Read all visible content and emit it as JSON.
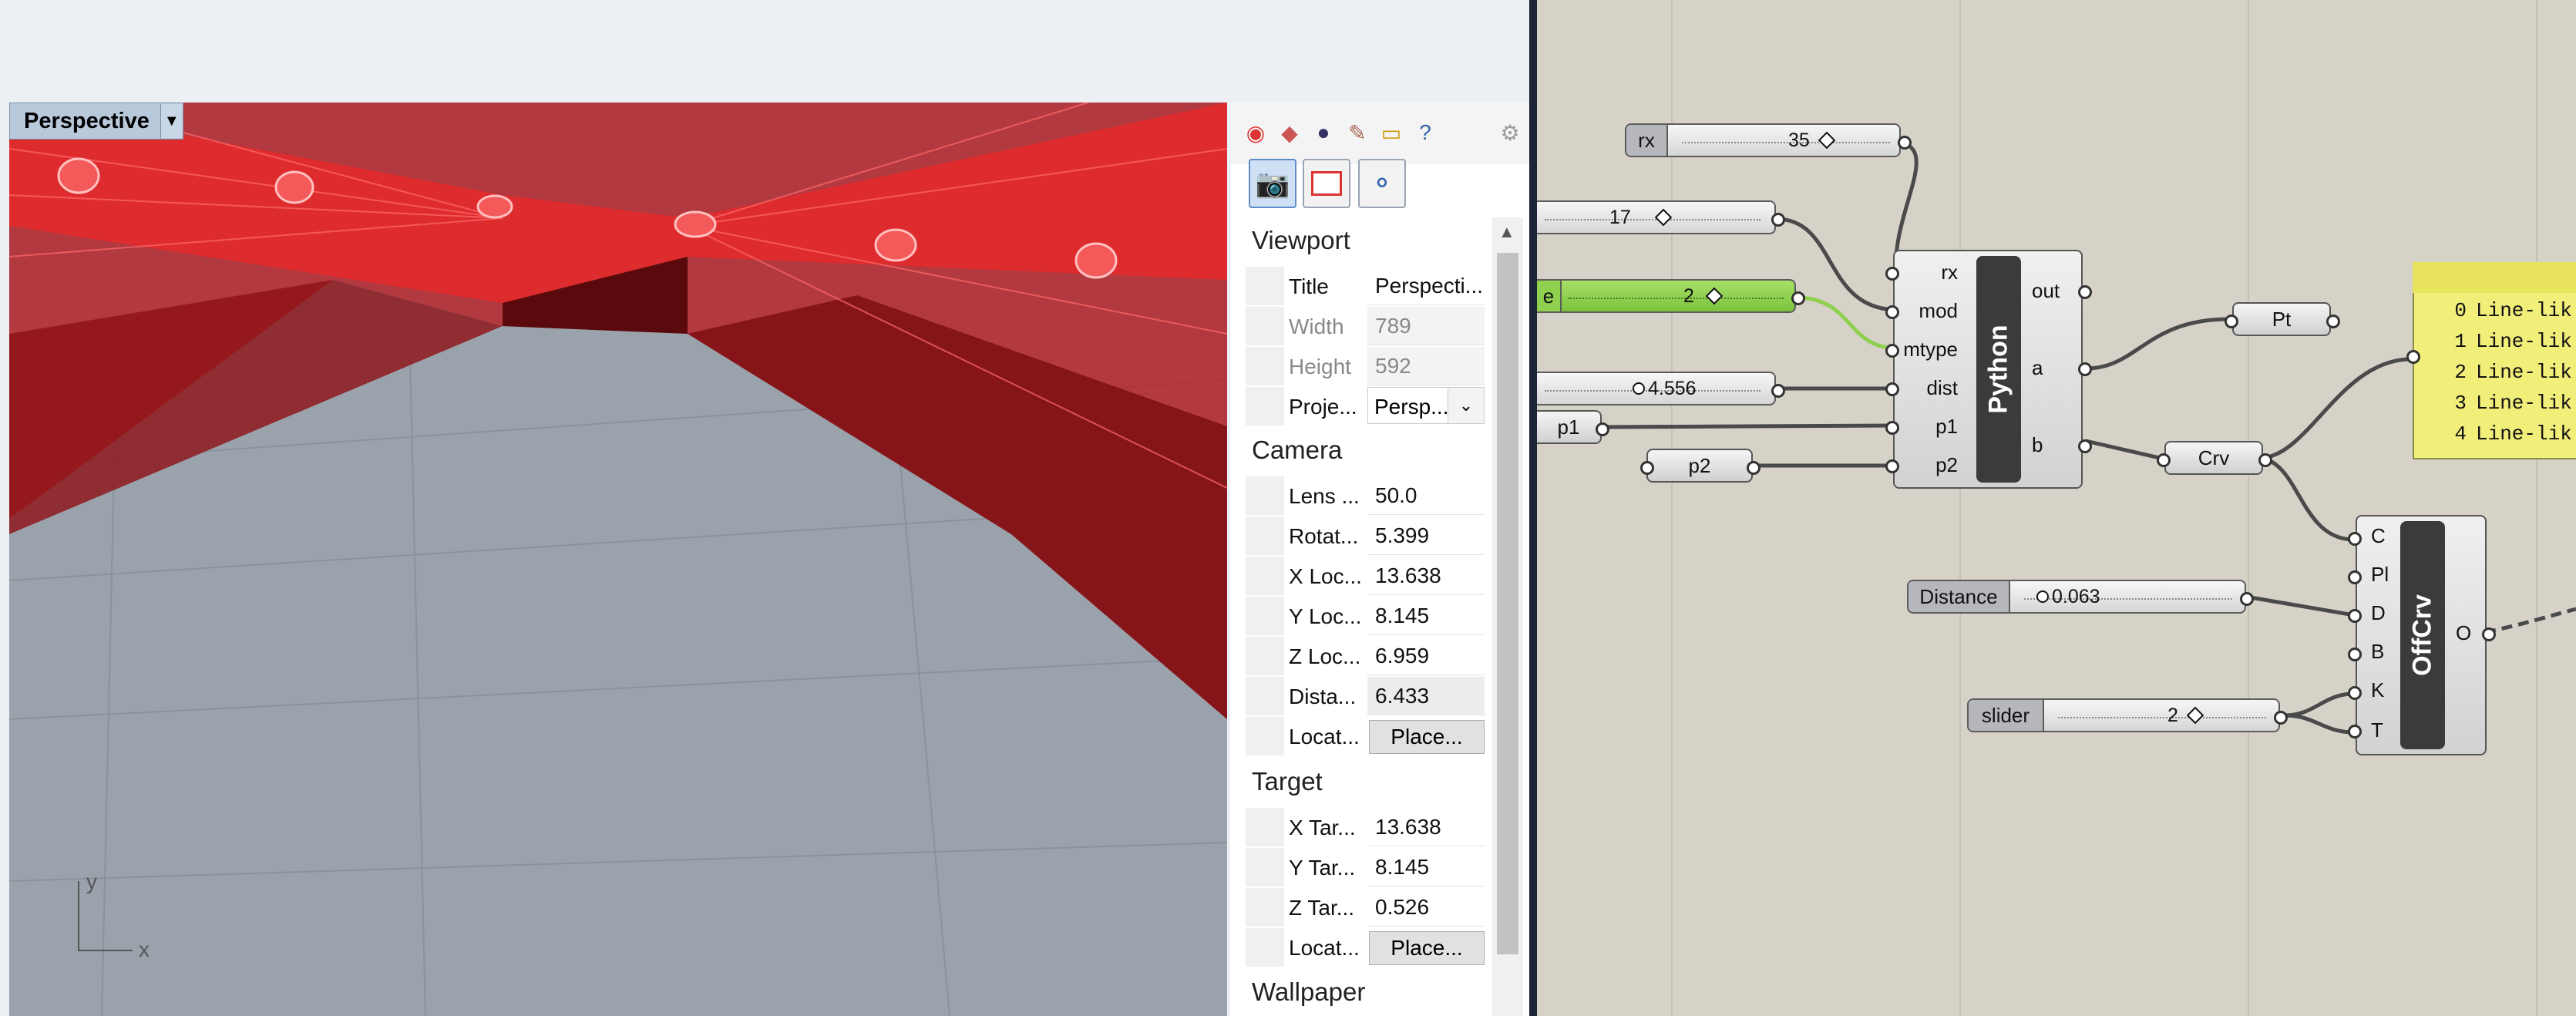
{
  "viewport": {
    "tab_label": "Perspective",
    "axis_y": "y",
    "axis_x": "x"
  },
  "properties": {
    "sections": {
      "viewport": "Viewport",
      "camera": "Camera",
      "target": "Target",
      "wallpaper": "Wallpaper"
    },
    "viewport_rows": [
      {
        "label": "Title",
        "value": "Perspecti..."
      },
      {
        "label": "Width",
        "value": "789"
      },
      {
        "label": "Height",
        "value": "592"
      },
      {
        "label": "Proje...",
        "value": "Persp..."
      }
    ],
    "camera_rows": [
      {
        "label": "Lens ...",
        "value": "50.0"
      },
      {
        "label": "Rotat...",
        "value": "5.399"
      },
      {
        "label": "X Loc...",
        "value": "13.638"
      },
      {
        "label": "Y Loc...",
        "value": "8.145"
      },
      {
        "label": "Z Loc...",
        "value": "6.959"
      },
      {
        "label": "Dista...",
        "value": "6.433"
      },
      {
        "label": "Locat...",
        "value": "Place..."
      }
    ],
    "target_rows": [
      {
        "label": "X Tar...",
        "value": "13.638"
      },
      {
        "label": "Y Tar...",
        "value": "8.145"
      },
      {
        "label": "Z Tar...",
        "value": "0.526"
      },
      {
        "label": "Locat...",
        "value": "Place..."
      }
    ]
  },
  "grasshopper": {
    "slider_rx": {
      "name": "rx",
      "value": "35"
    },
    "slider_17": {
      "value": "17"
    },
    "slider_green": {
      "name": "e",
      "value": "2"
    },
    "slider_dist": {
      "value": "4.556"
    },
    "param_p1": "p1",
    "param_p2": "p2",
    "python": {
      "title": "Python",
      "inputs": [
        "rx",
        "mod",
        "mtype",
        "dist",
        "p1",
        "p2"
      ],
      "outputs": [
        "out",
        "a",
        "b"
      ]
    },
    "param_pt": "Pt",
    "param_crv": "Crv",
    "slider_distance": {
      "name": "Distance",
      "value": "0.063"
    },
    "slider_slider": {
      "name": "slider",
      "value": "2"
    },
    "offcrv": {
      "title": "OffCrv",
      "inputs": [
        "C",
        "Pl",
        "D",
        "B",
        "K",
        "T"
      ],
      "output": "O"
    },
    "panel_items": [
      {
        "index": "0",
        "text": "Line-lik"
      },
      {
        "index": "1",
        "text": "Line-lik"
      },
      {
        "index": "2",
        "text": "Line-lik"
      },
      {
        "index": "3",
        "text": "Line-lik"
      },
      {
        "index": "4",
        "text": "Line-lik"
      }
    ]
  },
  "colors": {
    "model_red": "#c8141a",
    "viewport_gray": "#9aa2ab",
    "canvas": "#d6d2c8",
    "slider_green": "#8fd14f",
    "panel_yellow": "#f2ee7a"
  }
}
